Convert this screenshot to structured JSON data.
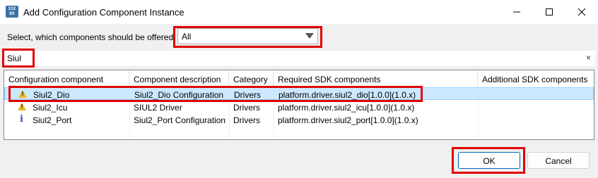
{
  "window": {
    "title": "Add Configuration Component Instance",
    "app_icon_text": "S32 DS",
    "controls": [
      "minimize-icon",
      "maximize-icon",
      "close-icon"
    ]
  },
  "offer": {
    "label": "Select, which components should be offered:",
    "selected": "All"
  },
  "filter": {
    "value": "Siul",
    "clear_glyph": "×"
  },
  "table": {
    "headers": [
      "Configuration component",
      "Component description",
      "Category",
      "Required SDK components",
      "Additional SDK components"
    ],
    "rows": [
      {
        "icon": "warning-icon",
        "name": "Siul2_Dio",
        "description": "Siul2_Dio Configuration",
        "category": "Drivers",
        "required": "platform.driver.siul2_dio[1.0.0](1.0.x)",
        "additional": "",
        "selected": true
      },
      {
        "icon": "warning-icon",
        "name": "Siul2_Icu",
        "description": "SIUL2 Driver",
        "category": "Drivers",
        "required": "platform.driver.siul2_icu[1.0.0](1.0.x)",
        "additional": "",
        "selected": false
      },
      {
        "icon": "info-icon",
        "name": "Siul2_Port",
        "description": "Siul2_Port Configuration",
        "category": "Drivers",
        "required": "platform.driver.siul2_port[1.0.0](1.0.x)",
        "additional": "",
        "selected": false
      }
    ]
  },
  "buttons": {
    "ok": "OK",
    "cancel": "Cancel"
  },
  "colors": {
    "highlight": "#e10000",
    "selection": "#cce8ff",
    "warning": "#e8b920",
    "info": "#2b57c8"
  }
}
